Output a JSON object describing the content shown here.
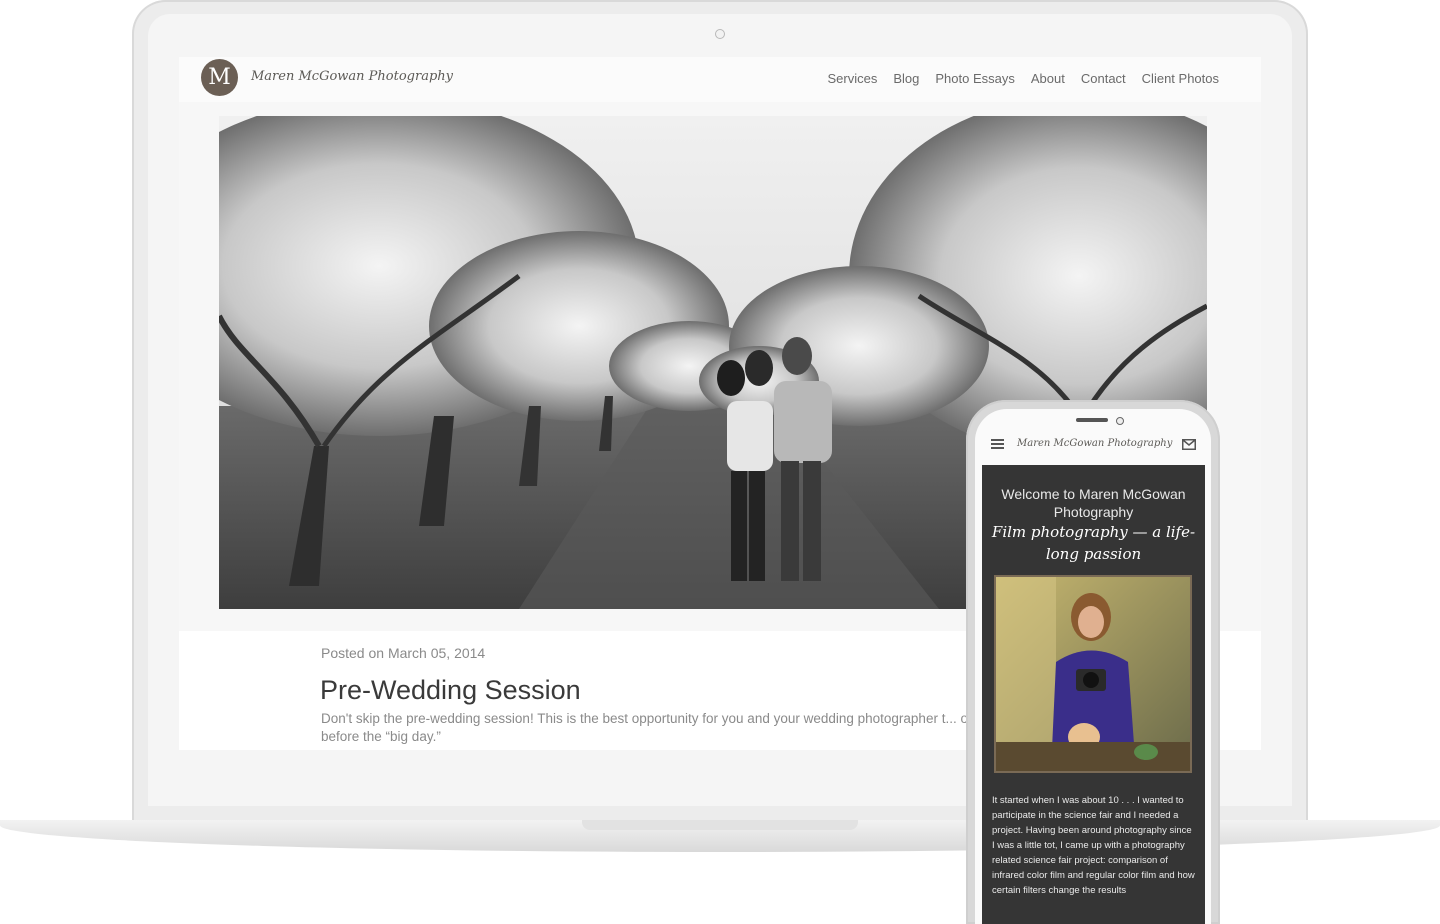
{
  "site": {
    "logo_letter": "M",
    "brand": "Maren McGowan Photography"
  },
  "nav": {
    "items": [
      "Services",
      "Blog",
      "Photo Essays",
      "About",
      "Contact",
      "Client Photos"
    ]
  },
  "post": {
    "date": "Posted on March 05, 2014",
    "title": "Pre-Wedding Session",
    "excerpt": "Don't skip the pre-wedding session! This is the best opportunity for you and your wedding photographer t... other before the “big day.”"
  },
  "mobile": {
    "brand": "Maren McGowan Photography",
    "welcome": "Welcome to Maren McGowan Photography",
    "tagline": "Film photography — a life-long passion",
    "body": "It started when I was about 10 . . . I wanted to participate in the science fair and I needed a project. Having been around photography since I was a little tot, I came up with a photography related science fair project: comparison of infrared color film and regular color film and how certain filters change the results",
    "icons": {
      "menu": "hamburger-menu-icon",
      "mail": "mail-icon"
    }
  },
  "colors": {
    "logo_badge": "#6b5f55",
    "mobile_bg": "#353535",
    "nav_text": "#6a6a6a"
  }
}
